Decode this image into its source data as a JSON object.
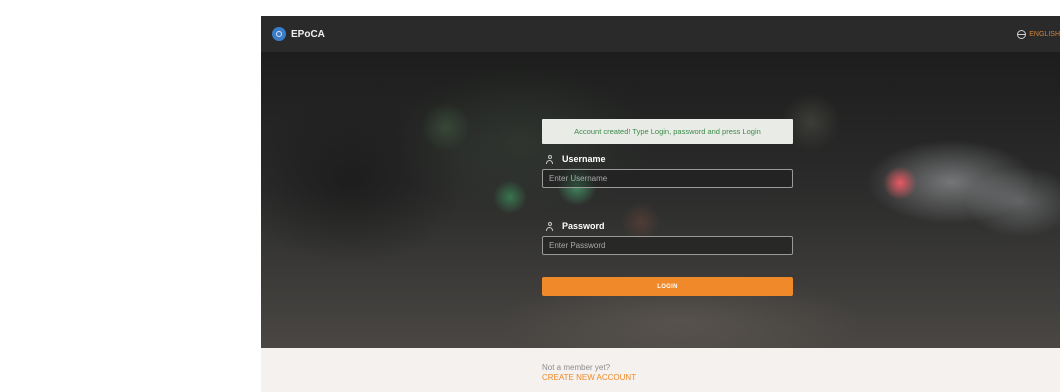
{
  "app": {
    "name": "EPoCA"
  },
  "language": {
    "label": "ENGLISH"
  },
  "alert": {
    "message": "Account created! Type Login, password and press Login"
  },
  "form": {
    "username": {
      "label": "Username",
      "placeholder": "Enter Username",
      "value": ""
    },
    "password": {
      "label": "Password",
      "placeholder": "Enter Password",
      "value": ""
    },
    "login_label": "LOGIN"
  },
  "footer": {
    "prompt": "Not a member yet?",
    "create_account_label": "CREATE NEW ACCOUNT"
  },
  "colors": {
    "accent": "#f0892a",
    "topbar": "#2a2a2a",
    "alert_bg": "#e9ece6",
    "alert_text": "#3c8a4a"
  }
}
